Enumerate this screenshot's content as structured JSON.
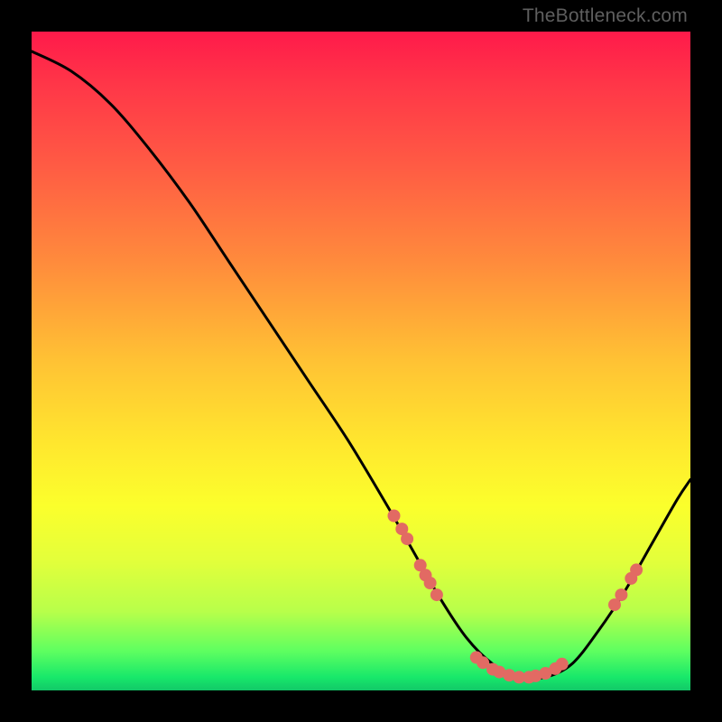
{
  "watermark": "TheBottleneck.com",
  "chart_data": {
    "type": "line",
    "title": "",
    "xlabel": "",
    "ylabel": "",
    "xlim": [
      0,
      100
    ],
    "ylim": [
      0,
      100
    ],
    "series": [
      {
        "name": "curve",
        "x": [
          0,
          6,
          12,
          18,
          24,
          30,
          36,
          42,
          48,
          54,
          58,
          62,
          66,
          70,
          74,
          78,
          82,
          86,
          90,
          94,
          98,
          100
        ],
        "y": [
          97,
          94,
          89,
          82,
          74,
          65,
          56,
          47,
          38,
          28,
          21,
          14,
          8,
          4,
          2,
          2,
          4,
          9,
          15,
          22,
          29,
          32
        ]
      }
    ],
    "markers": [
      {
        "x": 55.0,
        "y": 26.5
      },
      {
        "x": 56.2,
        "y": 24.5
      },
      {
        "x": 57.0,
        "y": 23.0
      },
      {
        "x": 59.0,
        "y": 19.0
      },
      {
        "x": 59.8,
        "y": 17.5
      },
      {
        "x": 60.5,
        "y": 16.3
      },
      {
        "x": 61.5,
        "y": 14.5
      },
      {
        "x": 67.5,
        "y": 5.0
      },
      {
        "x": 68.5,
        "y": 4.2
      },
      {
        "x": 70.0,
        "y": 3.2
      },
      {
        "x": 71.0,
        "y": 2.8
      },
      {
        "x": 72.5,
        "y": 2.3
      },
      {
        "x": 74.0,
        "y": 2.0
      },
      {
        "x": 75.5,
        "y": 2.0
      },
      {
        "x": 76.5,
        "y": 2.2
      },
      {
        "x": 78.0,
        "y": 2.6
      },
      {
        "x": 79.5,
        "y": 3.3
      },
      {
        "x": 80.5,
        "y": 4.0
      },
      {
        "x": 88.5,
        "y": 13.0
      },
      {
        "x": 89.5,
        "y": 14.5
      },
      {
        "x": 91.0,
        "y": 17.0
      },
      {
        "x": 91.8,
        "y": 18.3
      }
    ],
    "colors": {
      "curve": "#000000",
      "marker": "#e26a63"
    }
  }
}
